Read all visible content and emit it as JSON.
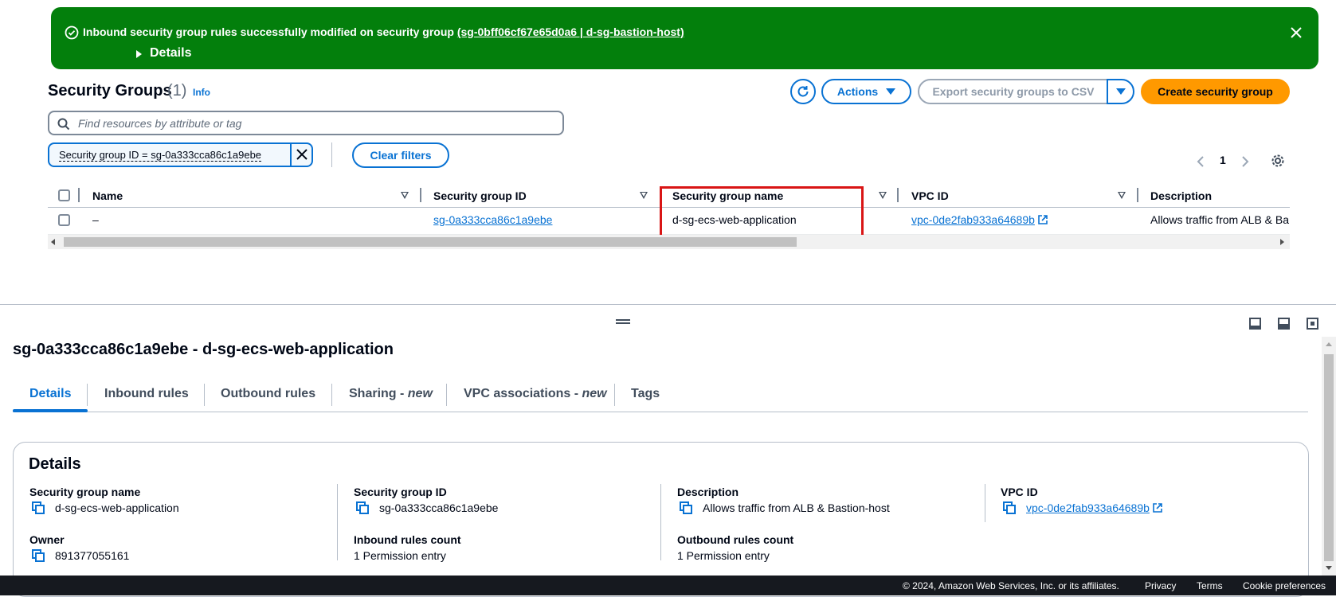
{
  "flash": {
    "message_prefix": "Inbound security group rules successfully modified on security group ",
    "message_link": "(sg-0bff06cf67e65d0a6 | d-sg-bastion-host)",
    "details_label": "Details"
  },
  "header": {
    "title": "Security Groups",
    "count": "(1)",
    "info": "Info",
    "actions_label": "Actions",
    "export_label": "Export security groups to CSV",
    "create_label": "Create security group"
  },
  "search": {
    "placeholder": "Find resources by attribute or tag"
  },
  "filter": {
    "token": "Security group ID = sg-0a333cca86c1a9ebe",
    "clear_label": "Clear filters"
  },
  "pagination": {
    "current_page": "1"
  },
  "table": {
    "columns": [
      "Name",
      "Security group ID",
      "Security group name",
      "VPC ID",
      "Description"
    ],
    "rows": [
      {
        "name": "–",
        "sg_id": "sg-0a333cca86c1a9ebe",
        "sg_name": "d-sg-ecs-web-application",
        "vpc_id": "vpc-0de2fab933a64689b",
        "description": "Allows traffic from ALB & Ba"
      }
    ]
  },
  "detail": {
    "title": "sg-0a333cca86c1a9ebe - d-sg-ecs-web-application",
    "tabs": [
      {
        "label": "Details",
        "suffix": ""
      },
      {
        "label": "Inbound rules",
        "suffix": ""
      },
      {
        "label": "Outbound rules",
        "suffix": ""
      },
      {
        "label": "Sharing - ",
        "suffix": "new"
      },
      {
        "label": "VPC associations - ",
        "suffix": "new"
      },
      {
        "label": "Tags",
        "suffix": ""
      }
    ],
    "card_title": "Details",
    "fields": {
      "sg_name_label": "Security group name",
      "sg_name_value": "d-sg-ecs-web-application",
      "sg_id_label": "Security group ID",
      "sg_id_value": "sg-0a333cca86c1a9ebe",
      "description_label": "Description",
      "description_value": "Allows traffic from ALB & Bastion-host",
      "vpc_label": "VPC ID",
      "vpc_value": "vpc-0de2fab933a64689b",
      "owner_label": "Owner",
      "owner_value": "891377055161",
      "inbound_label": "Inbound rules count",
      "inbound_value": "1 Permission entry",
      "outbound_label": "Outbound rules count",
      "outbound_value": "1 Permission entry"
    }
  },
  "footer": {
    "copyright": "© 2024, Amazon Web Services, Inc. or its affiliates.",
    "privacy": "Privacy",
    "terms": "Terms",
    "cookies": "Cookie preferences"
  },
  "colors": {
    "success": "#037f0c",
    "link": "#0972d3",
    "primary": "#ff9900",
    "highlight": "#d91515"
  }
}
